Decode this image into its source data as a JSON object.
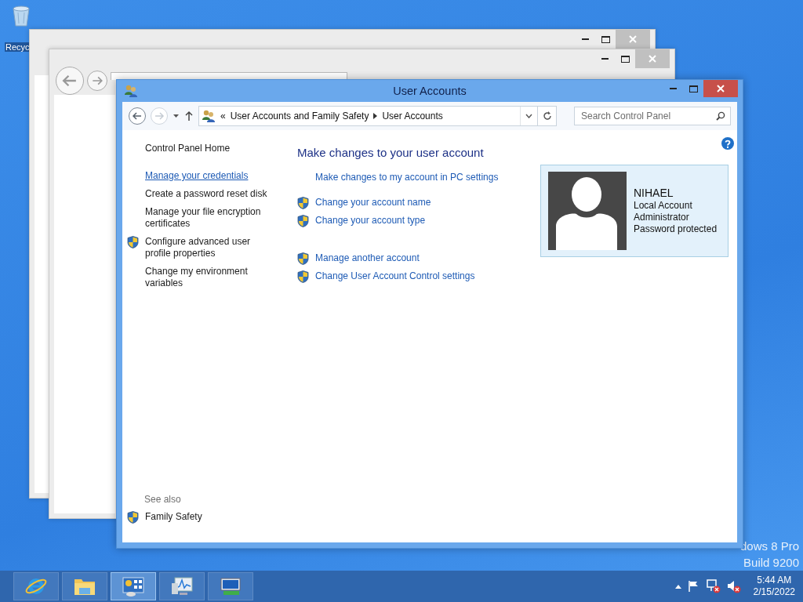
{
  "desktop": {
    "icons": [
      {
        "label": "Recyc"
      }
    ],
    "watermark": [
      "dows 8 Pro",
      "Build 9200"
    ]
  },
  "window": {
    "title": "User Accounts",
    "navigation": {
      "back": {
        "disabled": false
      },
      "forward": {
        "disabled": true
      }
    },
    "breadcrumb": {
      "prefix": "«",
      "items": [
        "User Accounts and Family Safety",
        "User Accounts"
      ]
    },
    "search": {
      "placeholder": "Search Control Panel"
    },
    "sidebar": {
      "items": [
        {
          "label": "Control Panel Home",
          "shield": false,
          "hovered": false
        },
        {
          "label": "Manage your credentials",
          "shield": false,
          "hovered": true
        },
        {
          "label": "Create a password reset disk",
          "shield": false,
          "hovered": false
        },
        {
          "label": "Manage your file encryption certificates",
          "shield": false,
          "hovered": false
        },
        {
          "label": "Configure advanced user profile properties",
          "shield": true,
          "hovered": false
        },
        {
          "label": "Change my environment variables",
          "shield": false,
          "hovered": false
        }
      ],
      "see_also": {
        "title": "See also",
        "items": [
          {
            "label": "Family Safety",
            "shield": true
          }
        ]
      }
    },
    "main": {
      "heading": "Make changes to your user account",
      "groups": [
        [
          {
            "label": "Make changes to my account in PC settings",
            "shield": false
          }
        ],
        [
          {
            "label": "Change your account name",
            "shield": true
          },
          {
            "label": "Change your account type",
            "shield": true
          }
        ],
        [
          {
            "label": "Manage another account",
            "shield": true
          },
          {
            "label": "Change User Account Control settings",
            "shield": true
          }
        ]
      ]
    },
    "account": {
      "name": "NIHAEL",
      "details": [
        "Local Account",
        "Administrator",
        "Password protected"
      ]
    }
  },
  "taskbar": {
    "apps": [
      {
        "kind": "browser",
        "selected": false
      },
      {
        "kind": "folder",
        "selected": false
      },
      {
        "kind": "control-panel",
        "selected": true
      },
      {
        "kind": "monitor",
        "selected": false
      },
      {
        "kind": "network",
        "selected": false
      }
    ],
    "tray": {
      "time": "5:44 AM",
      "date": "2/15/2022"
    }
  }
}
